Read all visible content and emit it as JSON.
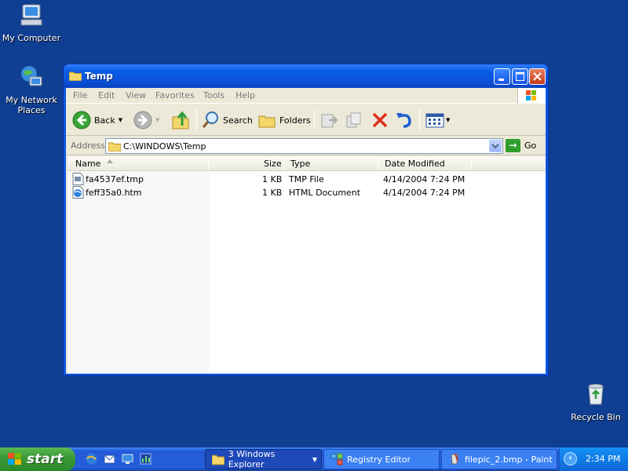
{
  "desktop": {
    "icons": [
      {
        "label": "My Computer",
        "icon": "my-computer-icon"
      },
      {
        "label": "My Network Places",
        "icon": "network-places-icon"
      },
      {
        "label": "Recycle Bin",
        "icon": "recycle-bin-icon"
      }
    ]
  },
  "window": {
    "title": "Temp",
    "menu": [
      "File",
      "Edit",
      "View",
      "Favorites",
      "Tools",
      "Help"
    ],
    "toolbar": {
      "back_label": "Back",
      "search_label": "Search",
      "folders_label": "Folders"
    },
    "address": {
      "label": "Address",
      "value": "C:\\WINDOWS\\Temp",
      "go_label": "Go"
    },
    "columns": [
      "Name",
      "Size",
      "Type",
      "Date Modified"
    ],
    "files": [
      {
        "name": "fa4537ef.tmp",
        "size": "1 KB",
        "type": "TMP File",
        "modified": "4/14/2004 7:24 PM",
        "icon": "tmp-file-icon"
      },
      {
        "name": "feff35a0.htm",
        "size": "1 KB",
        "type": "HTML Document",
        "modified": "4/14/2004 7:24 PM",
        "icon": "html-document-icon"
      }
    ]
  },
  "taskbar": {
    "start_label": "start",
    "tasks": [
      {
        "label": "3 Windows Explorer",
        "icon": "folder-icon"
      },
      {
        "label": "Registry Editor",
        "icon": "registry-editor-icon"
      },
      {
        "label": "filepic_2.bmp - Paint",
        "icon": "paint-icon"
      }
    ],
    "clock": "2:34 PM"
  },
  "colors": {
    "desktop": "#0f3f92",
    "titlebar": "#0a52d8",
    "taskbar": "#245edb",
    "start": "#3c9a37"
  }
}
